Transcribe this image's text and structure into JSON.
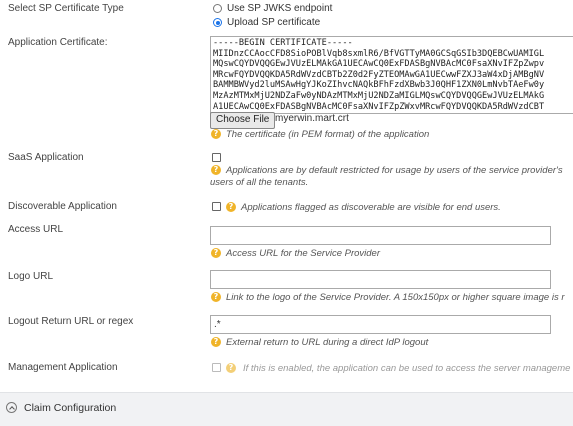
{
  "sp_cert_type": {
    "label": "Select SP Certificate Type",
    "options": [
      "Use SP JWKS endpoint",
      "Upload SP certificate"
    ],
    "selected": "Upload SP certificate"
  },
  "app_cert": {
    "label": "Application Certificate:",
    "lines": [
      "-----BEGIN CERTIFICATE-----",
      "MIIDnzCCAocCFD8SioPOBlVqb8sxmlR6/BfVGTTyMA0GCSqGSIb3DQEBCwUAMIGL",
      "MQswCQYDVQQGEwJVUzELMAkGA1UECAwCQ0ExFDASBgNVBAcMC0FsaXNvIFZpZwpv",
      "MRcwFQYDVQQKDA5RdWVzdCBTb2Z0d2FyZTEOMAwGA1UECwwFZXJ3aW4xDjAMBgNV",
      "BAMMBWVyd2luMSAwHgYJKoZIhvcNAQkBFhFzdXBwb3J0QHF1ZXN0LmNvbTAeFw0y",
      "MzAzMTMxMjU2NDZaFw0yNDAzMTMxMjU2NDZaMIGLMQswCQYDVQQGEwJVUzELMAkG",
      "A1UECAwCQ0ExFDASBgNVBAcMC0FsaXNvIFZpZWxvMRcwFQYDVQQKDA5RdWVzdCBT"
    ],
    "choose_file": "Choose File",
    "file_name": "myerwin.mart.crt",
    "hint": "The certificate (in PEM format) of the application"
  },
  "saas": {
    "label": "SaaS Application",
    "hint_line1": "Applications are by default restricted for usage by users of the service provider's",
    "hint_line2": "users of all the tenants."
  },
  "discoverable": {
    "label": "Discoverable Application",
    "hint": "Applications flagged as discoverable are visible for end users."
  },
  "access_url": {
    "label": "Access URL",
    "value": "",
    "hint": "Access URL for the Service Provider"
  },
  "logo_url": {
    "label": "Logo URL",
    "value": "",
    "hint": "Link to the logo of the Service Provider. A 150x150px or higher square image is r"
  },
  "logout_url": {
    "label": "Logout Return URL or regex",
    "value": ".*",
    "hint": "External return to URL during a direct IdP logout"
  },
  "management": {
    "label": "Management Application",
    "hint": "If this is enabled, the application can be used to access the server manageme"
  },
  "claim_section": {
    "title": "Claim Configuration"
  },
  "icons": {
    "help": "question-circle-icon",
    "collapse": "chevron-up-circle-icon"
  },
  "colors": {
    "accent": "#1a73e8",
    "help": "#f0b429",
    "footer_bg": "#f1f2f4"
  }
}
